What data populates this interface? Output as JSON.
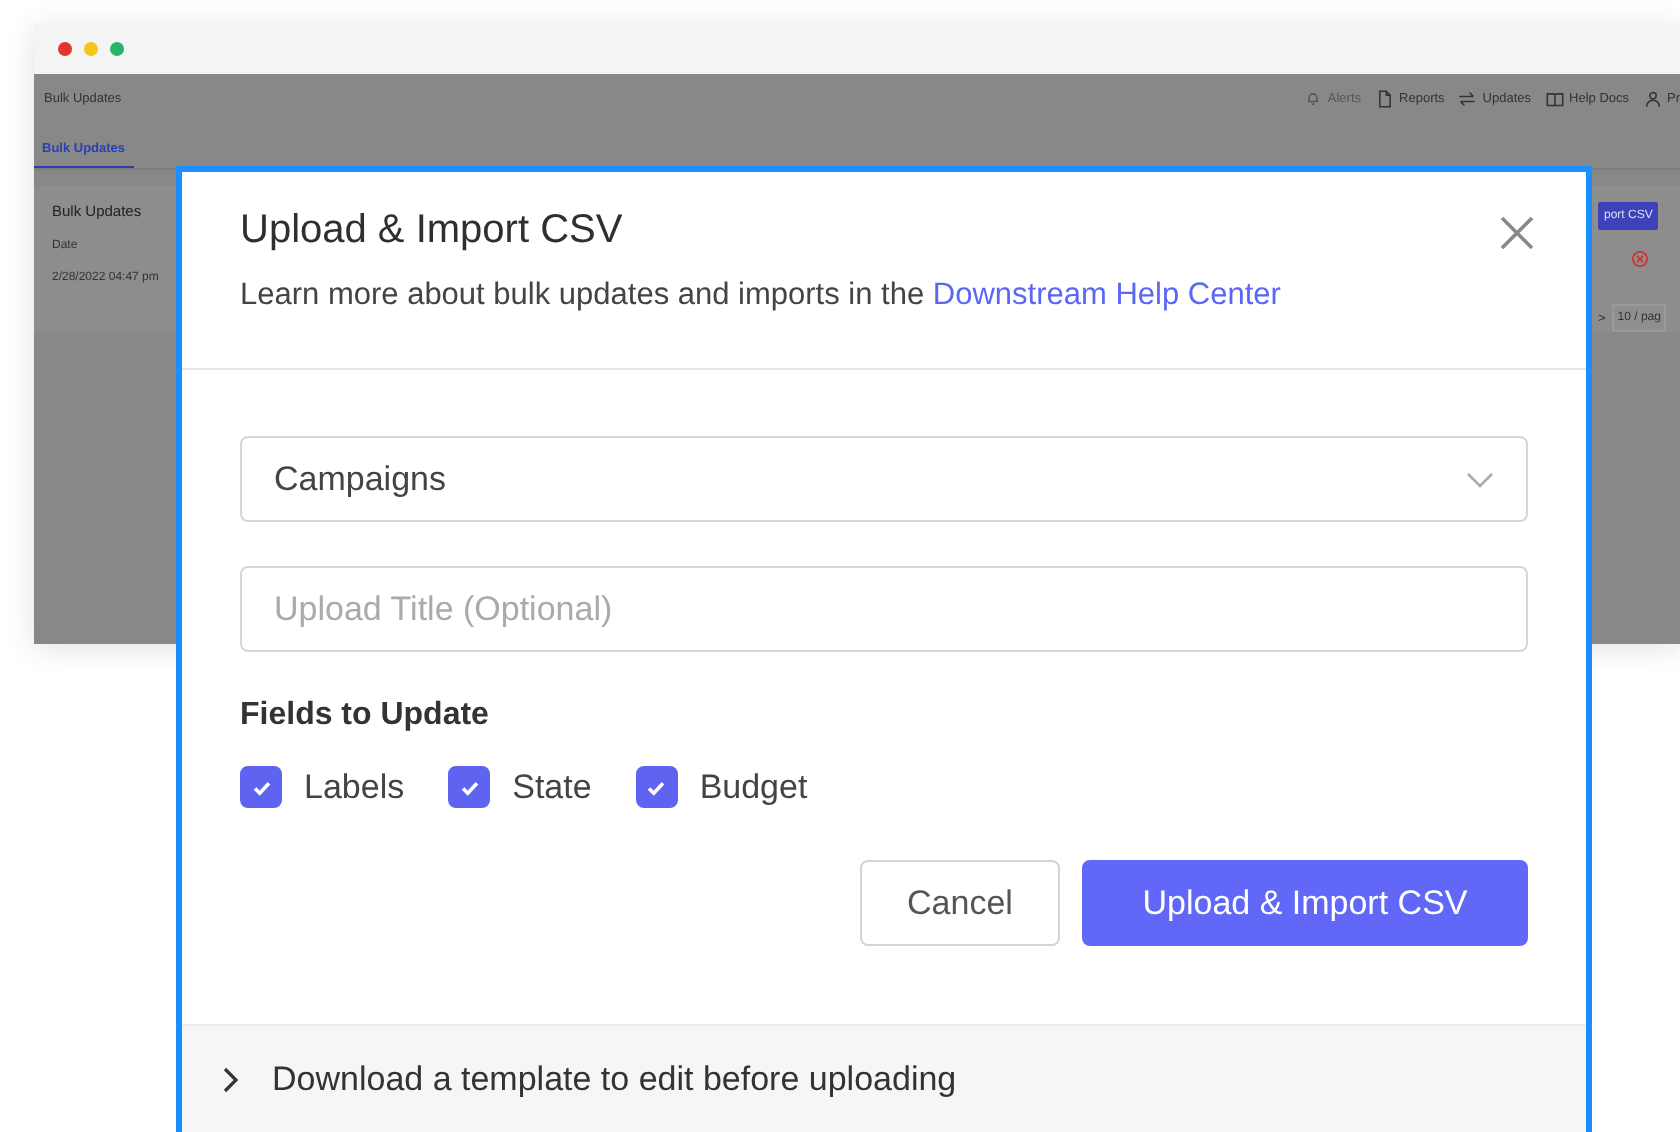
{
  "app": {
    "breadcrumb": "Bulk Updates",
    "nav": [
      {
        "label": "Alerts",
        "disabled": true
      },
      {
        "label": "Reports",
        "disabled": false
      },
      {
        "label": "Updates",
        "disabled": false
      },
      {
        "label": "Help Docs",
        "disabled": false
      },
      {
        "label": "Pr",
        "disabled": false
      }
    ],
    "tabs": [
      {
        "label": "Bulk Updates",
        "selected": true
      }
    ],
    "panel": {
      "title": "Bulk Updates",
      "import_button": "port CSV",
      "columns": [
        "Date"
      ],
      "rows": [
        {
          "date": "2/28/2022 04:47 pm"
        }
      ],
      "pager_next": ">",
      "page_size": "10 / pag"
    }
  },
  "modal": {
    "title": "Upload & Import CSV",
    "subtitle": "Learn more about bulk updates and imports in the ",
    "link": "Downstream Help Center",
    "select": {
      "value": "Campaigns"
    },
    "title_field": {
      "placeholder": "Upload Title (Optional)"
    },
    "fields_label": "Fields to Update",
    "fields": [
      {
        "label": "Labels",
        "checked": true
      },
      {
        "label": "State",
        "checked": true
      },
      {
        "label": "Budget",
        "checked": true
      }
    ],
    "cancel": "Cancel",
    "submit": "Upload & Import CSV",
    "footer": "Download a template to edit before uploading"
  }
}
